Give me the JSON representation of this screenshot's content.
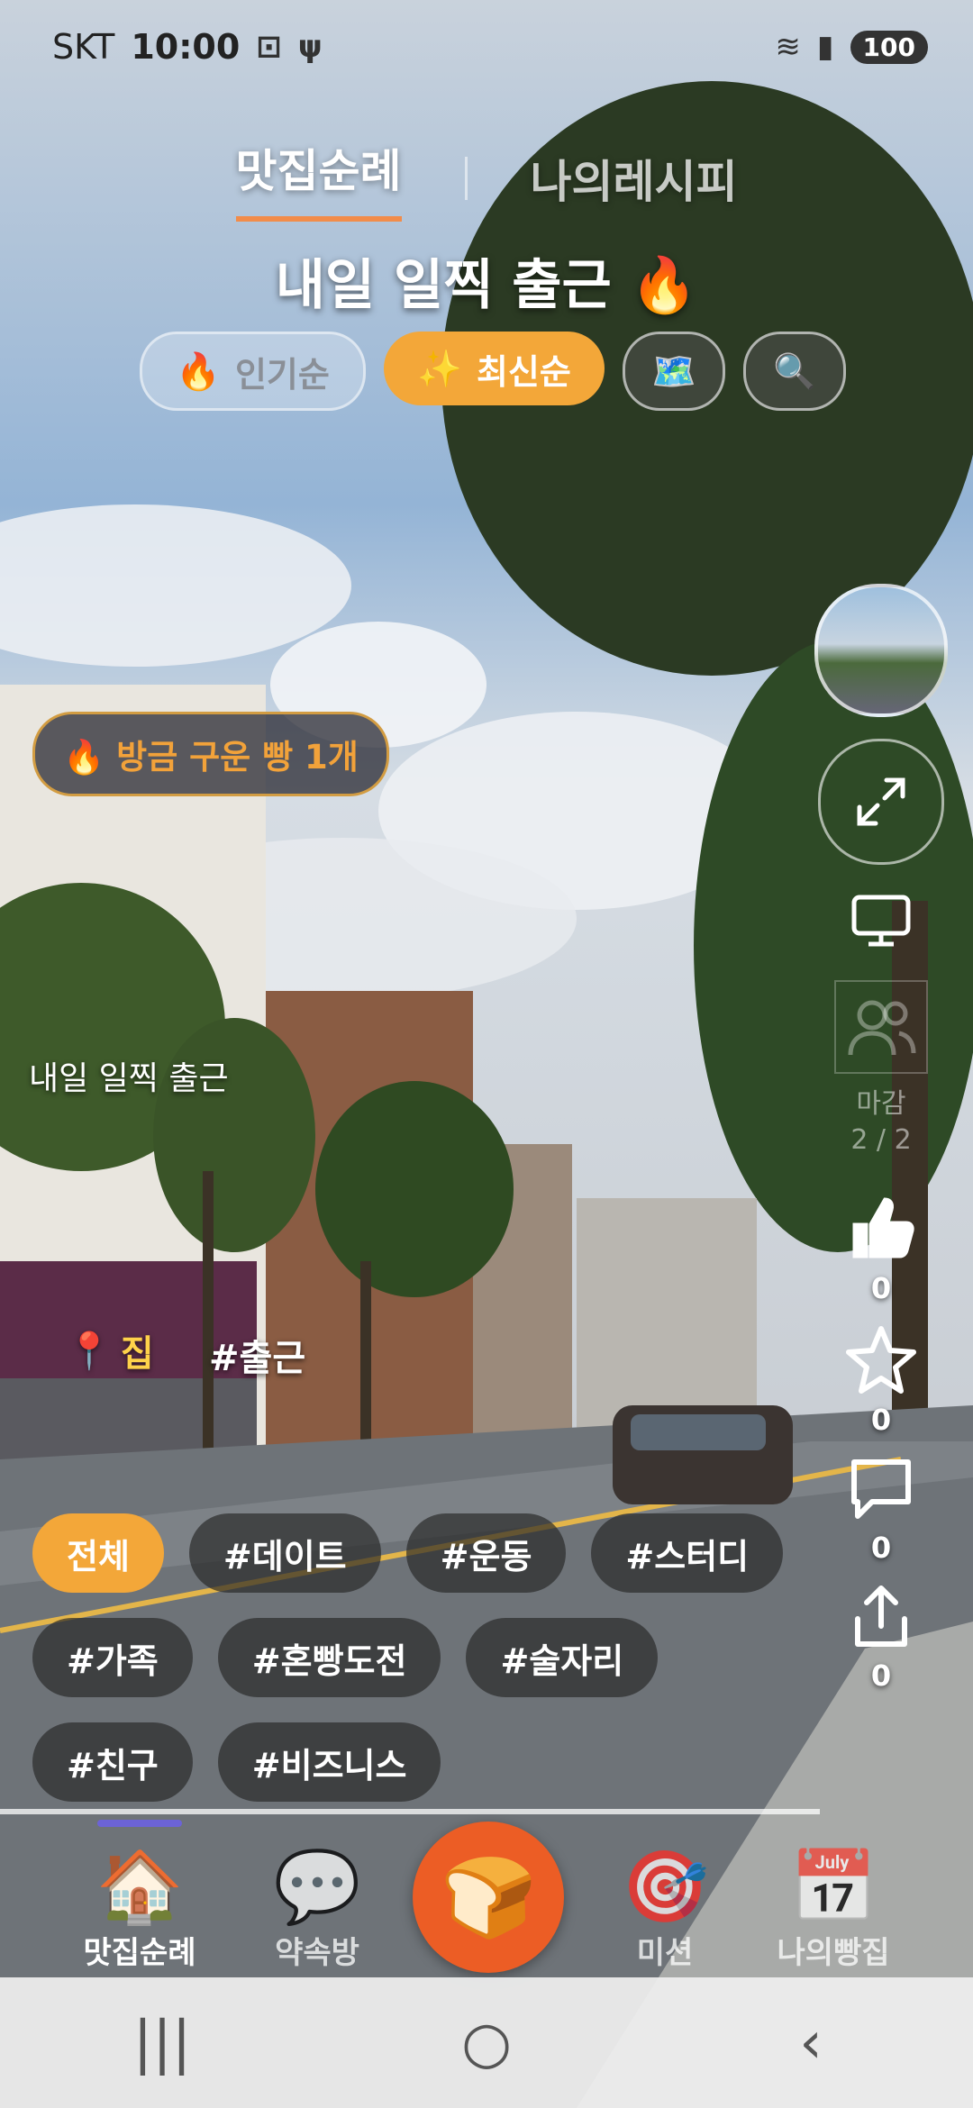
{
  "status_bar": {
    "carrier": "SKT",
    "time": "10:00",
    "battery": "100"
  },
  "tabs": [
    {
      "label": "맛집순례",
      "active": true
    },
    {
      "label": "나의레시피",
      "active": false
    }
  ],
  "title": "내일 일찍 출근 🔥",
  "sort": {
    "popular": {
      "emoji": "🔥",
      "label": "인기순"
    },
    "latest": {
      "emoji": "✨",
      "label": "최신순"
    },
    "map_icon": "🗺️",
    "search_icon": "🔍"
  },
  "badge": "🔥 방금 구운 빵 1개",
  "caption": "내일 일찍 출근",
  "location": {
    "pin": "📍",
    "label": "집"
  },
  "hashtag": "#출근",
  "rail": {
    "status_label": "마감",
    "page": "2 / 2",
    "like_count": "0",
    "star_count": "0",
    "comment_count": "0",
    "share_count": "0"
  },
  "chips": {
    "row1": [
      "전체",
      "#데이트",
      "#운동",
      "#스터디"
    ],
    "row2": [
      "#가족",
      "#혼빵도전",
      "#술자리"
    ],
    "row3": [
      "#친구",
      "#비즈니스"
    ]
  },
  "nav": {
    "home": {
      "icon": "🏠",
      "label": "맛집순례"
    },
    "chat": {
      "icon": "💬",
      "label": "약속방"
    },
    "center": {
      "icon": "🍞"
    },
    "mission": {
      "icon": "🎯",
      "label": "미션"
    },
    "mybakery": {
      "icon": "📅",
      "label": "나의빵집"
    }
  },
  "system_nav": {
    "recent": "|||",
    "home": "○",
    "back": "‹"
  },
  "colors": {
    "accent": "#f3a739",
    "brand": "#ec5d25",
    "tab_underline": "#f28c4a"
  }
}
